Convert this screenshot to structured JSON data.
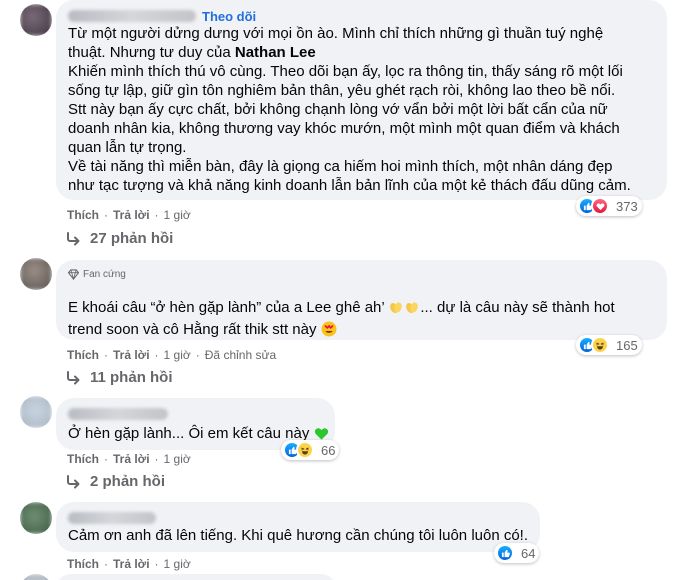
{
  "comments": [
    {
      "follow_label": "Theo dõi",
      "text_part1": "Từ một người dửng dưng với mọi ồn ào. Mình chỉ thích những gì thuần tuý nghệ\nthuật. Nhưng tư duy của ",
      "mention": "Nathan Lee",
      "text_part2": "\nKhiến mình thích thú vô cùng. Theo dõi bạn ấy, lọc ra thông tin, thấy sáng rõ một lối\nsống tự lập, giữ gìn tôn nghiêm bản thân, yêu ghét rạch ròi, không lao theo bề nổi.\nStt này bạn ấy cực chất, bởi không chạnh lòng vớ vẩn bởi một lời bất cẩn của nữ\ndoanh nhân kia, không thương vay khóc mướn, một mình một quan điểm và khách\nquan lẫn tự trọng.\nVề tài năng thì miễn bàn, đây là giọng ca hiếm hoi mình thích, một nhân dáng đẹp\nnhư tạc tượng và khả năng kinh doanh lẫn bản lĩnh của một kẻ thách đấu dũng cảm.",
      "like_label": "Thích",
      "reply_label": "Trả lời",
      "time": "1 giờ",
      "reaction_count": "373",
      "replies_label": "27 phản hồi",
      "reaction_icons": [
        "like-icon",
        "love-icon"
      ]
    },
    {
      "badge_label": "Fan cứng",
      "text_part1": "E khoái câu “ở hèn gặp lành” của a Lee ghê ah’ ",
      "text_part2": "... dự là câu này sẽ thành hot\ntrend soon và cô Hằng rất thik stt này ",
      "like_label": "Thích",
      "reply_label": "Trả lời",
      "time": "1 giờ",
      "edited_label": "Đã chỉnh sửa",
      "reaction_count": "165",
      "replies_label": "11 phản hồi",
      "reaction_icons": [
        "like-icon",
        "haha-icon"
      ]
    },
    {
      "text": "Ở hèn gặp lành... Ôi em kết câu này ",
      "like_label": "Thích",
      "reply_label": "Trả lời",
      "time": "1 giờ",
      "reaction_count": "66",
      "replies_label": "2 phản hồi",
      "reaction_icons": [
        "like-icon",
        "haha-icon"
      ]
    },
    {
      "text": "Cảm ơn anh đã lên tiếng. Khi quê hương cần chúng tôi luôn luôn có!.",
      "like_label": "Thích",
      "reply_label": "Trả lời",
      "time": "1 giờ",
      "reaction_count": "64",
      "reaction_icons": [
        "like-icon"
      ]
    }
  ],
  "separator": "·",
  "colors": {
    "follow": "#216fdb",
    "bubble": "#f0f2f5",
    "meta": "#65676b",
    "like": "#0062df",
    "love": "#e61739"
  }
}
